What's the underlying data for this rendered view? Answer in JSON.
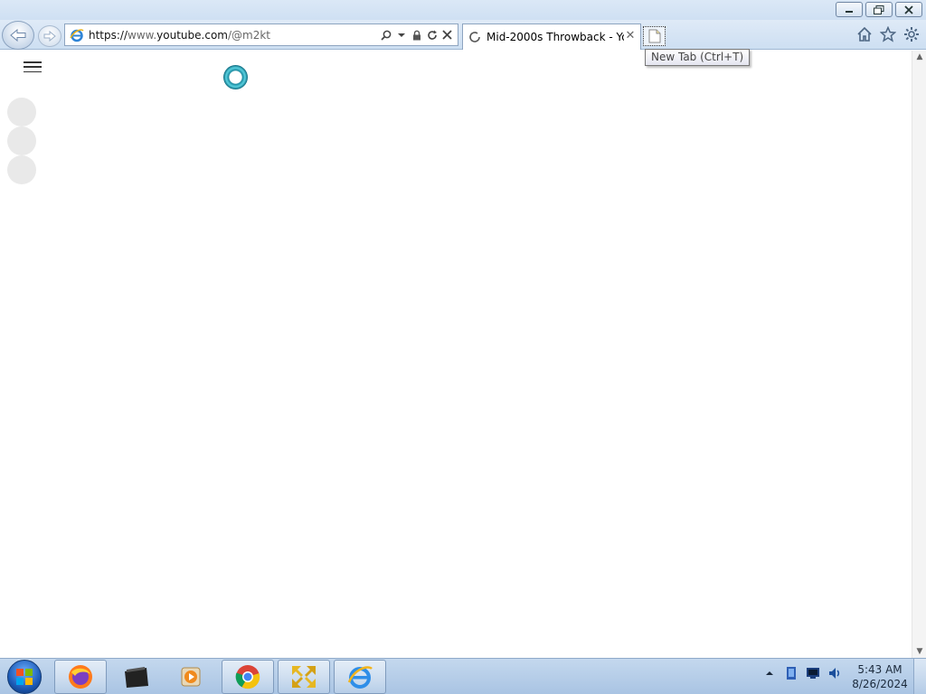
{
  "browser": {
    "address": {
      "scheme": "https://",
      "host_prefix": "www.",
      "host": "youtube.com",
      "path": "/@m2kt"
    },
    "tab": {
      "title": "Mid-2000s Throwback - Yo..."
    },
    "tooltip": "New Tab (Ctrl+T)"
  },
  "taskbar": {
    "clock": {
      "time": "5:43 AM",
      "date": "8/26/2024"
    }
  },
  "colors": {
    "accent": "#1c5bb7",
    "chrome": "#cddff2",
    "spinner": "#1a8aa0"
  }
}
